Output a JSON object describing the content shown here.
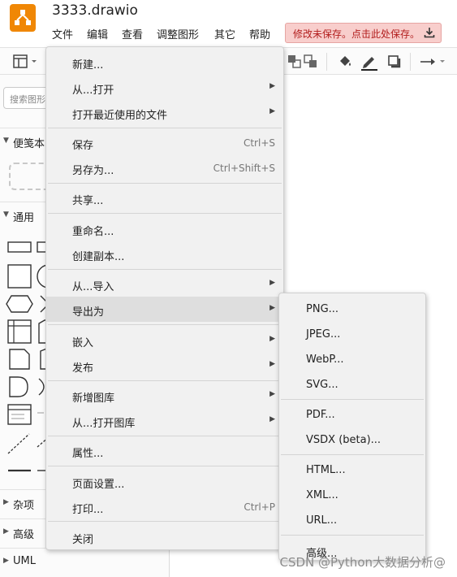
{
  "app": {
    "title": "3333.drawio"
  },
  "menubar": [
    "文件",
    "编辑",
    "查看",
    "调整图形",
    "其它",
    "帮助"
  ],
  "unsaved_notice": "修改未保存。点击此处保存。",
  "sidebar": {
    "search_placeholder": "搜索图形",
    "sections": [
      {
        "label": "便笺本",
        "expanded": true
      },
      {
        "label": "通用",
        "expanded": true
      },
      {
        "label": "杂项",
        "expanded": false
      },
      {
        "label": "高级",
        "expanded": false
      },
      {
        "label": "UML",
        "expanded": false
      }
    ]
  },
  "file_menu": {
    "items": [
      {
        "label": "新建...",
        "shortcut": "",
        "submenu": false
      },
      {
        "label": "从...打开",
        "shortcut": "",
        "submenu": true
      },
      {
        "label": "打开最近使用的文件",
        "shortcut": "",
        "submenu": true
      },
      {
        "label": "保存",
        "shortcut": "Ctrl+S",
        "submenu": false
      },
      {
        "label": "另存为...",
        "shortcut": "Ctrl+Shift+S",
        "submenu": false
      },
      {
        "label": "共享...",
        "shortcut": "",
        "submenu": false
      },
      {
        "label": "重命名...",
        "shortcut": "",
        "submenu": false
      },
      {
        "label": "创建副本...",
        "shortcut": "",
        "submenu": false
      },
      {
        "label": "从...导入",
        "shortcut": "",
        "submenu": true
      },
      {
        "label": "导出为",
        "shortcut": "",
        "submenu": true,
        "highlighted": true
      },
      {
        "label": "嵌入",
        "shortcut": "",
        "submenu": true
      },
      {
        "label": "发布",
        "shortcut": "",
        "submenu": true
      },
      {
        "label": "新增图库",
        "shortcut": "",
        "submenu": true
      },
      {
        "label": "从...打开图库",
        "shortcut": "",
        "submenu": true
      },
      {
        "label": "属性...",
        "shortcut": "",
        "submenu": false
      },
      {
        "label": "页面设置...",
        "shortcut": "",
        "submenu": false
      },
      {
        "label": "打印...",
        "shortcut": "Ctrl+P",
        "submenu": false
      },
      {
        "label": "关闭",
        "shortcut": "",
        "submenu": false
      }
    ]
  },
  "export_menu": {
    "items": [
      "PNG...",
      "JPEG...",
      "WebP...",
      "SVG...",
      "PDF...",
      "VSDX (beta)...",
      "HTML...",
      "XML...",
      "URL...",
      "高级..."
    ]
  },
  "watermark": "CSDN @Python大数据分析@"
}
